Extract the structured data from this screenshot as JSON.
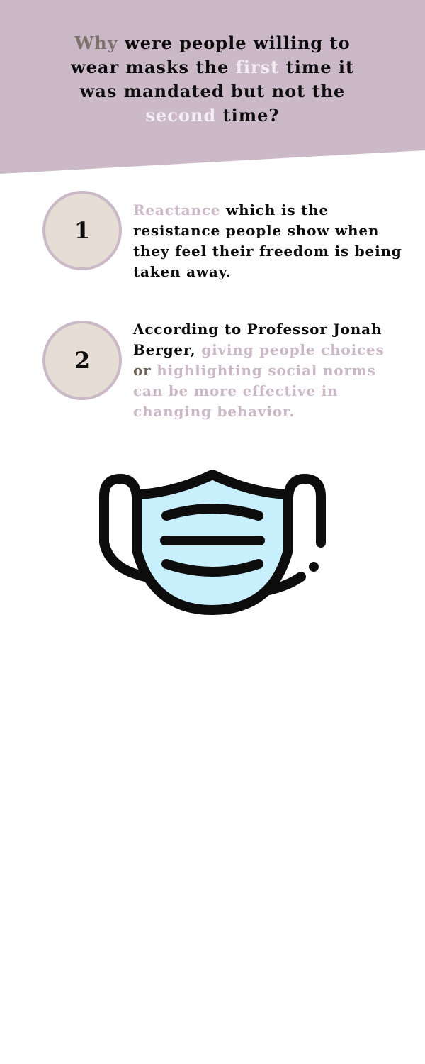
{
  "colors": {
    "header_bg": "#cbb9c8",
    "accent_mauve": "#cbb9c8",
    "accent_grey": "#7a716a",
    "accent_white": "#f4eef2",
    "circle_fill": "#e6ddd4",
    "mask_fill": "#c8effc",
    "text": "#0d0d0d"
  },
  "header": {
    "q1": "Why",
    "q2": " were people willing to wear masks the ",
    "q3": "first",
    "q4": " time it was mandated but not the ",
    "q5": "second",
    "q6": " time?"
  },
  "items": [
    {
      "number": "1",
      "t1": "Reactance",
      "t2": " which is the resistance people show when they feel their freedom is being taken away."
    },
    {
      "number": "2",
      "t1": "According to Professor Jonah Berger, ",
      "t2": "giving people choices",
      "t3": " or ",
      "t4": "highlighting social norms can be more effective in changing behavior."
    }
  ],
  "illustration": {
    "icon": "face-mask-icon"
  }
}
